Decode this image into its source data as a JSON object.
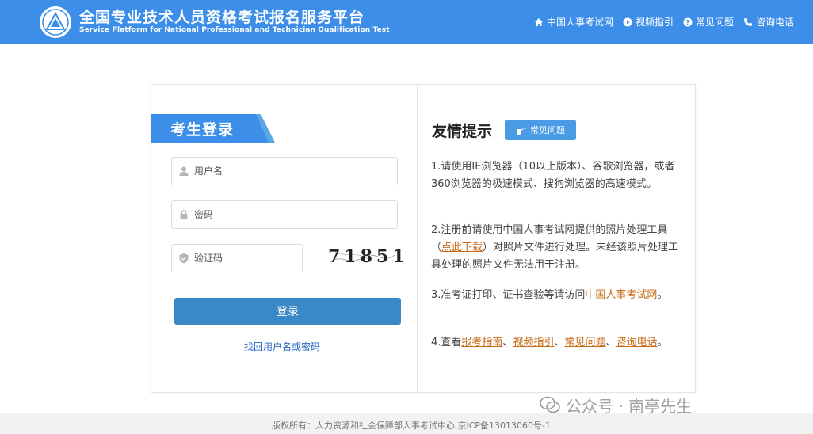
{
  "header": {
    "title_cn": "全国专业技术人员资格考试报名服务平台",
    "title_en": "Service Platform for National Professional and Technician Qualification Test",
    "logo_icon": "triangle-emblem-icon",
    "nav": [
      {
        "label": "中国人事考试网",
        "icon": "home-icon"
      },
      {
        "label": "视频指引",
        "icon": "play-icon"
      },
      {
        "label": "常见问题",
        "icon": "question-icon"
      },
      {
        "label": "咨询电话",
        "icon": "phone-icon"
      }
    ],
    "bg_color": "#3c8ee8"
  },
  "login": {
    "tab_label": "考生登录",
    "username_placeholder": "用户名",
    "password_placeholder": "密码",
    "captcha_placeholder": "验证码",
    "captcha_text": "71851",
    "submit_label": "登录",
    "forgot_label": "找回用户名或密码",
    "button_color": "#3b88c6"
  },
  "tips": {
    "title": "友情提示",
    "faq_badge": "常见问题",
    "tip1": "1.请使用IE浏览器（10以上版本）、谷歌浏览器，或者360浏览器的极速模式、搜狗浏览器的高速模式。",
    "tip2_pre": "2.注册前请使用中国人事考试网提供的照片处理工具（",
    "tip2_link": "点此下载",
    "tip2_post": "）对照片文件进行处理。未经该照片处理工具处理的照片文件无法用于注册。",
    "tip3_pre": "3.准考证打印、证书查验等请访问",
    "tip3_link": "中国人事考试网",
    "tip3_post": "。",
    "tip4_pre": "4.查看",
    "tip4_links": [
      "报考指南",
      "视频指引",
      "常见问题",
      "咨询电话"
    ],
    "tip4_sep": "、",
    "tip4_post": "。"
  },
  "footer": {
    "copyright": "版权所有：人力资源和社会保障部人事考试中心 京ICP备13013060号-1"
  },
  "watermark": {
    "text": "公众号 · 南亭先生"
  }
}
